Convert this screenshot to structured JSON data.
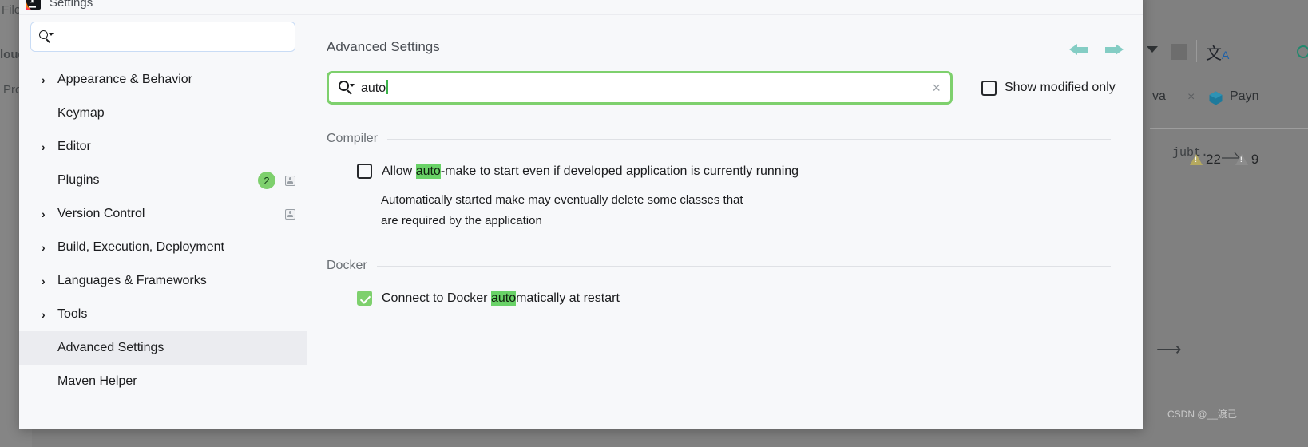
{
  "background": {
    "menu_file": "File",
    "menu_cloud": "loud",
    "menu_project": "Pro",
    "tab_name": "va",
    "tab_close": "×",
    "module_name": "Payn",
    "translate_glyph": "文",
    "translate_sub": "A",
    "code_fragment": "jubt.",
    "warning_count": "22",
    "weak_warning_count": "9",
    "long_arrow": "⟶",
    "watermark": "CSDN @__渡己"
  },
  "dialog": {
    "title": "Settings",
    "app_icon_name": "intellij-idea-icon"
  },
  "sidebar": {
    "search": {
      "value": "",
      "placeholder": ""
    },
    "items": [
      {
        "label": "Appearance & Behavior",
        "expandable": true,
        "selected": false,
        "badge": null,
        "has_card_icon": false
      },
      {
        "label": "Keymap",
        "expandable": false,
        "selected": false,
        "badge": null,
        "has_card_icon": false
      },
      {
        "label": "Editor",
        "expandable": true,
        "selected": false,
        "badge": null,
        "has_card_icon": false
      },
      {
        "label": "Plugins",
        "expandable": false,
        "selected": false,
        "badge": "2",
        "has_card_icon": true
      },
      {
        "label": "Version Control",
        "expandable": true,
        "selected": false,
        "badge": null,
        "has_card_icon": true
      },
      {
        "label": "Build, Execution, Deployment",
        "expandable": true,
        "selected": false,
        "badge": null,
        "has_card_icon": false
      },
      {
        "label": "Languages & Frameworks",
        "expandable": true,
        "selected": false,
        "badge": null,
        "has_card_icon": false
      },
      {
        "label": "Tools",
        "expandable": true,
        "selected": false,
        "badge": null,
        "has_card_icon": false
      },
      {
        "label": "Advanced Settings",
        "expandable": false,
        "selected": true,
        "badge": null,
        "has_card_icon": false
      },
      {
        "label": "Maven Helper",
        "expandable": false,
        "selected": false,
        "badge": null,
        "has_card_icon": false
      }
    ]
  },
  "content": {
    "page_title": "Advanced Settings",
    "search": {
      "value": "auto",
      "clear_label": "×"
    },
    "show_modified_only": {
      "label": "Show modified only",
      "checked": false
    },
    "groups": [
      {
        "title": "Compiler",
        "checkbox_checked": false,
        "label_before": "Allow ",
        "label_match": "auto",
        "label_after": "-make to start even if developed application is currently running",
        "description_line1": "Automatically started make may eventually delete some classes that",
        "description_line2": "are required by the application"
      },
      {
        "title": "Docker",
        "checkbox_checked": true,
        "label_before": "Connect to Docker ",
        "label_match": "auto",
        "label_after": "matically at restart",
        "description_line1": "",
        "description_line2": ""
      }
    ]
  },
  "colors": {
    "accent_green": "#7ed06d",
    "highlight_green": "#69d267",
    "arrow_teal": "#84cdc4",
    "dialog_bg": "#f7f8fa",
    "selected_row": "#ebecf0"
  }
}
